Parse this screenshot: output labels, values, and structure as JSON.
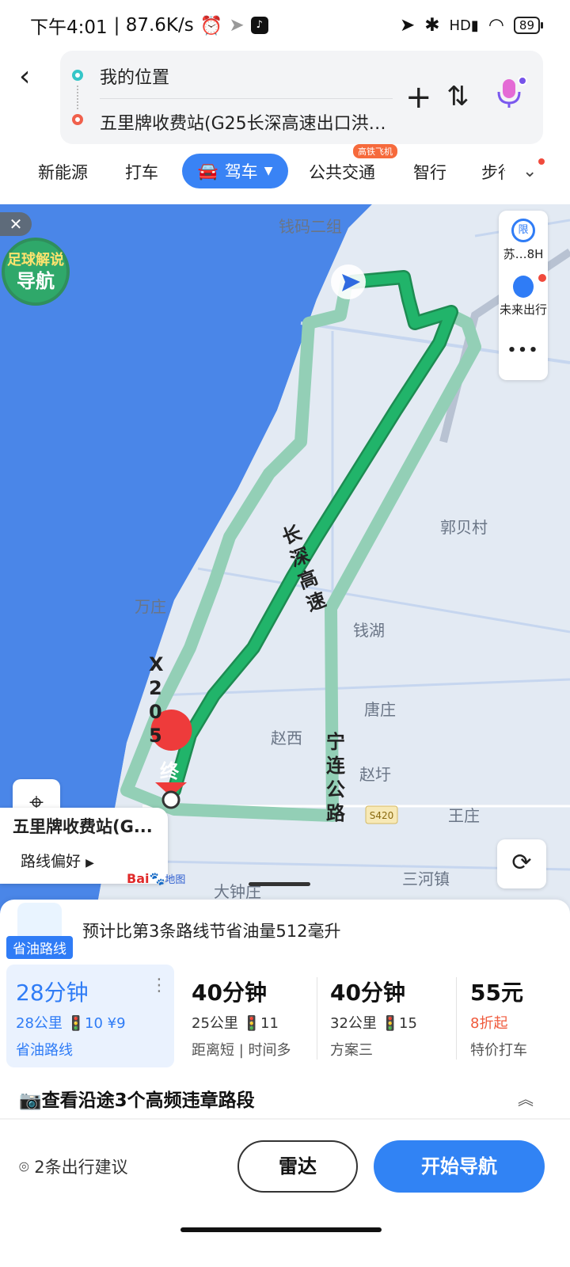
{
  "status_bar": {
    "time": "下午4:01",
    "speed": "| 87.6K/s",
    "battery": "89",
    "icons": [
      "alarm-icon",
      "location-arrow-icon",
      "tiktok-icon",
      "bluetooth-icon",
      "hd-signal-icon",
      "wifi-icon",
      "battery-icon"
    ]
  },
  "header": {
    "from": "我的位置",
    "to": "五里牌收费站(G25长深高速出口洪…",
    "colors": {
      "start_dot": "#35c6c8",
      "end_dot": "#f0604c"
    }
  },
  "tabs": {
    "items": [
      "新能源",
      "打车",
      "驾车",
      "公共交通",
      "智行",
      "步行"
    ],
    "active": "驾车",
    "transit_badge": "高铁飞机"
  },
  "map": {
    "labels": {
      "qianma": "钱码二组",
      "guobei": "郭贝村",
      "wanzhuang": "万庄",
      "qianhu": "钱湖",
      "tangzhuang": "唐庄",
      "zhaoxi": "赵西",
      "zhaoyu": "赵圩",
      "wangzhuang": "王庄",
      "sanhe": "三河镇",
      "dazhong": "大钟庄",
      "s420": "S420"
    },
    "road_x205": [
      "X",
      "2",
      "0",
      "5"
    ],
    "road_ninglian": [
      "宁",
      "连",
      "公",
      "路"
    ],
    "road_changshen": [
      "长",
      "深",
      "高",
      "速"
    ],
    "end_marker": "终",
    "promo_line1": "足球解说",
    "promo_line2": "导航",
    "close": "✕",
    "side_tools": {
      "limit_icon_text": "限",
      "limit_label": "苏…8H",
      "future_label": "未来出行",
      "more": "•••"
    },
    "dest_name": "五里牌收费站(G...",
    "pref": "路线偏好",
    "logo_main": "Bai",
    "logo_sub": "地图",
    "colors": {
      "route": "#21b46a",
      "alt_route": "#93cfb6",
      "water": "#4a86e8"
    }
  },
  "panel": {
    "tip_badge": "省油路线",
    "tip_text": "预计比第3条路线节省油量512毫升",
    "options": [
      {
        "time": "28分钟",
        "meta": "28公里 🚦10 ¥9",
        "tag": "省油路线"
      },
      {
        "time": "40分钟",
        "meta": "25公里 🚦11",
        "tag": "距离短 | 时间多"
      },
      {
        "time": "40分钟",
        "meta": "32公里 🚦15",
        "tag": "方案三"
      },
      {
        "time": "55元",
        "tag_red": "8折起",
        "tag": "特价打车"
      }
    ],
    "violation": "查看沿途3个高频违章路段",
    "suggest": "2条出行建议",
    "radar": "雷达",
    "navigate": "开始导航"
  }
}
